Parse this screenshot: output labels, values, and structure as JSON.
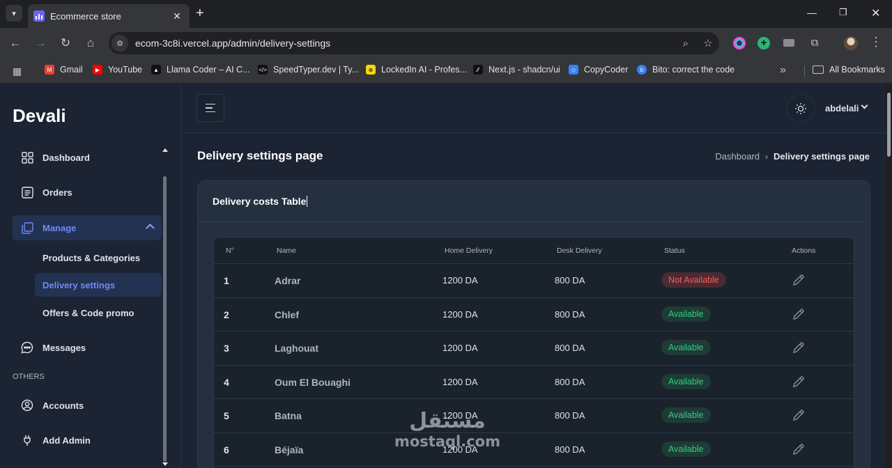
{
  "browser": {
    "tab_title": "Ecommerce store",
    "url": "ecom-3c8i.vercel.app/admin/delivery-settings",
    "bookmarks": [
      {
        "label": "Gmail",
        "color": "#ea4335",
        "glyph": "M"
      },
      {
        "label": "YouTube",
        "color": "#ff0000",
        "glyph": "▶"
      },
      {
        "label": "Llama Coder – AI C...",
        "color": "#111111",
        "glyph": "▲"
      },
      {
        "label": "SpeedTyper.dev | Ty...",
        "color": "#111111",
        "glyph": "</>"
      },
      {
        "label": "LockedIn AI - Profes...",
        "color": "#f5d90a",
        "glyph": "⊕"
      },
      {
        "label": "Next.js - shadcn/ui",
        "color": "#111111",
        "glyph": "⁄⁄"
      },
      {
        "label": "CopyCoder",
        "color": "#3b82f6",
        "glyph": "◇"
      },
      {
        "label": "Bito: correct the code",
        "color": "#3b82f6",
        "glyph": "b"
      }
    ],
    "all_bookmarks": "All Bookmarks"
  },
  "sidebar": {
    "brand": "Devali",
    "items": {
      "dashboard": "Dashboard",
      "orders": "Orders",
      "manage": "Manage",
      "products": "Products & Categories",
      "delivery": "Delivery settings",
      "offers": "Offers & Code promo",
      "messages": "Messages",
      "others": "OTHERS",
      "accounts": "Accounts",
      "add_admin": "Add Admin"
    }
  },
  "header": {
    "user": "abdelali"
  },
  "page": {
    "title": "Delivery settings page",
    "breadcrumb_home": "Dashboard",
    "breadcrumb_current": "Delivery settings page",
    "card_title": "Delivery costs Table"
  },
  "table": {
    "headers": {
      "num": "N°",
      "name": "Name",
      "home": "Home Delivery",
      "desk": "Desk Delivery",
      "status": "Status",
      "actions": "Actions"
    },
    "rows": [
      {
        "num": "1",
        "name": "Adrar",
        "home": "1200 DA",
        "desk": "800 DA",
        "status": "Not Available",
        "available": false
      },
      {
        "num": "2",
        "name": "Chlef",
        "home": "1200 DA",
        "desk": "800 DA",
        "status": "Available",
        "available": true
      },
      {
        "num": "3",
        "name": "Laghouat",
        "home": "1200 DA",
        "desk": "800 DA",
        "status": "Available",
        "available": true
      },
      {
        "num": "4",
        "name": "Oum El Bouaghi",
        "home": "1200 DA",
        "desk": "800 DA",
        "status": "Available",
        "available": true
      },
      {
        "num": "5",
        "name": "Batna",
        "home": "1200 DA",
        "desk": "800 DA",
        "status": "Available",
        "available": true
      },
      {
        "num": "6",
        "name": "Béjaïa",
        "home": "1200 DA",
        "desk": "800 DA",
        "status": "Available",
        "available": true
      }
    ]
  },
  "watermark": {
    "arabic": "مستقل",
    "latin": "mostaql.com"
  },
  "colors": {
    "accent": "#6d8bf5",
    "available": "#2fd083",
    "not_available": "#ff5c5c"
  }
}
